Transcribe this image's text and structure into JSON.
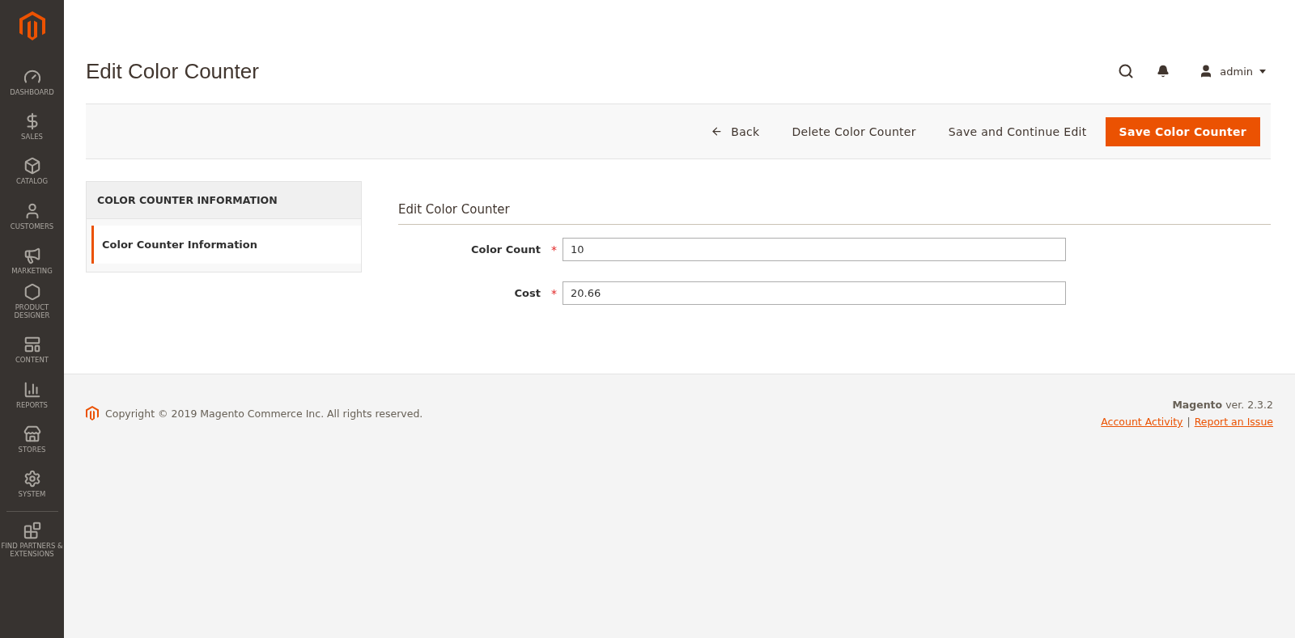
{
  "sidebar": {
    "items": [
      {
        "label": "DASHBOARD"
      },
      {
        "label": "SALES"
      },
      {
        "label": "CATALOG"
      },
      {
        "label": "CUSTOMERS"
      },
      {
        "label": "MARKETING"
      },
      {
        "label": "PRODUCT DESIGNER"
      },
      {
        "label": "CONTENT"
      },
      {
        "label": "REPORTS"
      },
      {
        "label": "STORES"
      },
      {
        "label": "SYSTEM"
      },
      {
        "label": "FIND PARTNERS & EXTENSIONS"
      }
    ]
  },
  "header": {
    "title": "Edit Color Counter",
    "user": "admin"
  },
  "actions": [
    {
      "label": "Back",
      "kind": "back"
    },
    {
      "label": "Delete Color Counter",
      "kind": "plain"
    },
    {
      "label": "Save and Continue Edit",
      "kind": "plain"
    },
    {
      "label": "Save Color Counter",
      "kind": "primary"
    }
  ],
  "tabs": {
    "title": "COLOR COUNTER INFORMATION",
    "items": [
      {
        "label": "Color Counter Information",
        "selected": true
      }
    ]
  },
  "form": {
    "title": "Edit Color Counter",
    "fields": [
      {
        "label": "Color Count",
        "required_mark": "*",
        "value": "10"
      },
      {
        "label": "Cost",
        "required_mark": "*",
        "value": "20.66"
      }
    ]
  },
  "footer": {
    "copyright": "Copyright © 2019 Magento Commerce Inc. All rights reserved.",
    "version": "**Magento** ver. 2.3.2",
    "links": [
      {
        "label": "Account Activity"
      },
      {
        "label": "Report an Issue"
      }
    ],
    "separator": "|"
  }
}
